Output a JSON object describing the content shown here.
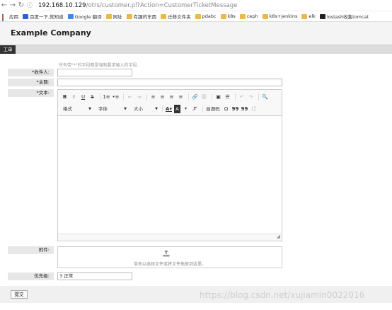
{
  "browser": {
    "url_host": "192.168.10.129",
    "url_path": "/otrs/customer.pl?Action=CustomerTicketMessage",
    "bookmarks": [
      {
        "label": "应用",
        "icon": "apps-icon"
      },
      {
        "label": "百度一下,就知道",
        "icon": "baidu-icon"
      },
      {
        "label": "Google 翻译",
        "icon": "google-translate-icon"
      },
      {
        "label": "网址",
        "icon": "folder-icon"
      },
      {
        "label": "有趣的东西",
        "icon": "folder-icon"
      },
      {
        "label": "迁移文件夹",
        "icon": "folder-icon"
      },
      {
        "label": "pdabc",
        "icon": "folder-icon"
      },
      {
        "label": "k8s",
        "icon": "folder-icon"
      },
      {
        "label": "ceph",
        "icon": "folder-icon"
      },
      {
        "label": "k8s+jenkins",
        "icon": "folder-icon"
      },
      {
        "label": "elk",
        "icon": "folder-icon"
      },
      {
        "label": "lostash收集tomcat",
        "icon": "page-icon"
      }
    ]
  },
  "header": {
    "company": "Example Company"
  },
  "nav": {
    "ticket": "工单"
  },
  "form": {
    "hint": "所有带\"*\"的字段都是强制要求输入的字段.",
    "to_label": "收件人:",
    "subject_label": "主题:",
    "text_label": "文本:",
    "attachment_label": "附件:",
    "priority_label": "优先级:",
    "priority_value": "3 正常",
    "required_mark": "*",
    "drop_text": "单击以选择文件或将文件拖放到这里。",
    "submit": "提交"
  },
  "editor": {
    "row1": [
      "B",
      "I",
      "U",
      "S",
      "1≡",
      "•≡",
      "⇤",
      "⇥",
      "≡",
      "≡",
      "≡",
      "≡",
      "🔗",
      "⛓",
      "▣",
      "☰",
      "↶",
      "↷",
      "🔍"
    ],
    "format": "格式",
    "font": "字体",
    "size": "大小",
    "source": "源码",
    "omega": "Ω",
    "quote_open": "99",
    "quote_close": "99"
  },
  "watermark": "https://blog.csdn.net/xujiamin0022016",
  "colors": {
    "accent_dark": "#333333",
    "label_bg": "#e7e7e7",
    "header_bg": "#f4f4f4"
  }
}
